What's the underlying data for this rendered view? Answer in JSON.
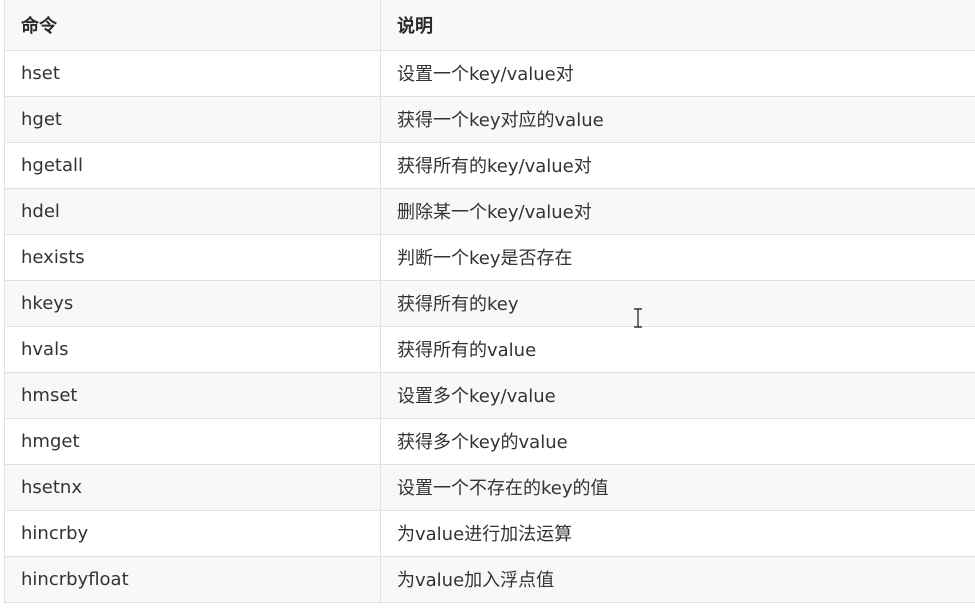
{
  "table": {
    "headers": [
      "命令",
      "说明"
    ],
    "rows": [
      {
        "cmd": "hset",
        "desc": "设置一个key/value对"
      },
      {
        "cmd": "hget",
        "desc": "获得一个key对应的value"
      },
      {
        "cmd": "hgetall",
        "desc": "获得所有的key/value对"
      },
      {
        "cmd": "hdel",
        "desc": "删除某一个key/value对"
      },
      {
        "cmd": "hexists",
        "desc": "判断一个key是否存在"
      },
      {
        "cmd": "hkeys",
        "desc": "获得所有的key"
      },
      {
        "cmd": "hvals",
        "desc": "获得所有的value"
      },
      {
        "cmd": "hmset",
        "desc": "设置多个key/value"
      },
      {
        "cmd": "hmget",
        "desc": "获得多个key的value"
      },
      {
        "cmd": "hsetnx",
        "desc": "设置一个不存在的key的值"
      },
      {
        "cmd": "hincrby",
        "desc": "为value进行加法运算"
      },
      {
        "cmd": "hincrbyfloat",
        "desc": "为value加入浮点值"
      }
    ]
  },
  "cursor": {
    "icon": "text-cursor-icon"
  }
}
